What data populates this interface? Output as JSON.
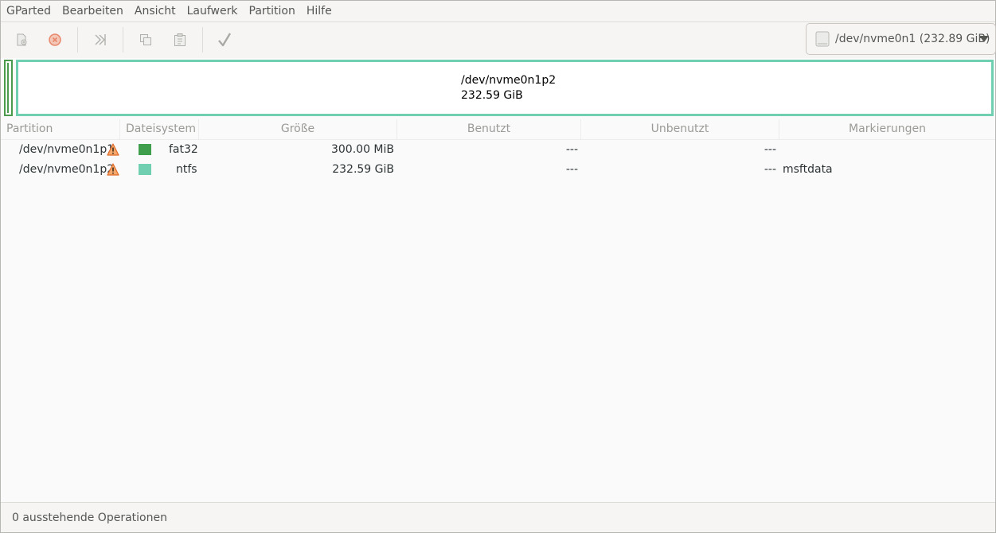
{
  "menubar": {
    "items": [
      "GParted",
      "Bearbeiten",
      "Ansicht",
      "Laufwerk",
      "Partition",
      "Hilfe"
    ]
  },
  "toolbar": {
    "buttons": [
      "new-partition",
      "delete-partition",
      "resize-move",
      "copy",
      "paste",
      "apply"
    ],
    "device_select": "/dev/nvme0n1 (232.89 GiB)"
  },
  "visual": {
    "partition_name": "/dev/nvme0n1p2",
    "partition_size": "232.59 GiB"
  },
  "table": {
    "headers": [
      "Partition",
      "Dateisystem",
      "Größe",
      "Benutzt",
      "Unbenutzt",
      "Markierungen"
    ],
    "rows": [
      {
        "partition": "/dev/nvme0n1p1",
        "filesystem": "fat32",
        "color": "#3f9e4b",
        "size": "300.00 MiB",
        "used": "---",
        "unused": "---",
        "flags": ""
      },
      {
        "partition": "/dev/nvme0n1p2",
        "filesystem": "ntfs",
        "color": "#6fcfb0",
        "size": "232.59 GiB",
        "used": "---",
        "unused": "---",
        "flags": "msftdata"
      }
    ]
  },
  "statusbar": {
    "text": "0 ausstehende Operationen"
  }
}
